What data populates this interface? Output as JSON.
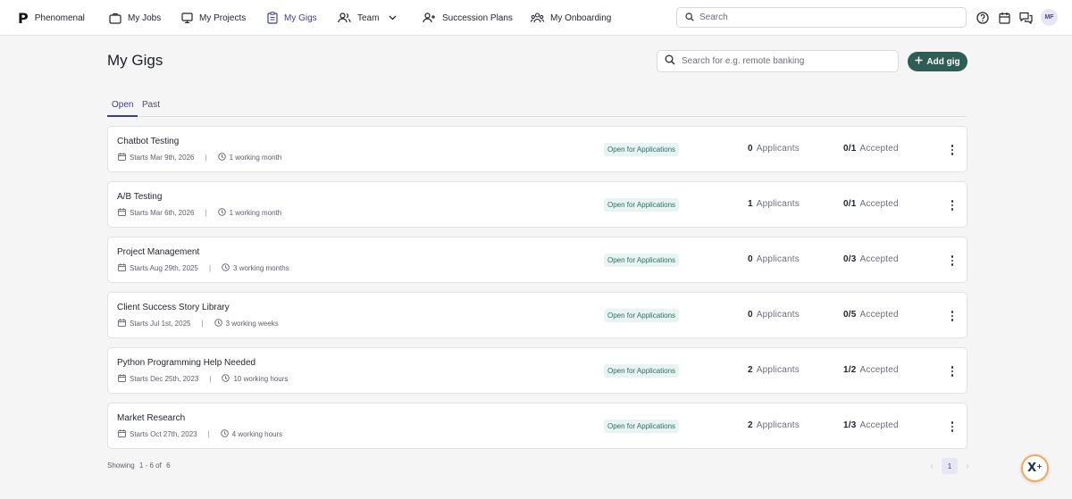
{
  "brand": {
    "name": "Phenomenal"
  },
  "nav": {
    "my_jobs": "My Jobs",
    "my_projects": "My Projects",
    "my_gigs": "My Gigs",
    "team": "Team",
    "succession_plans": "Succession Plans",
    "my_onboarding": "My Onboarding"
  },
  "top_search": {
    "placeholder": "Search"
  },
  "user": {
    "initials": "MF"
  },
  "page": {
    "title": "My Gigs",
    "search_placeholder": "Search for e.g. remote banking",
    "add_gig_label": "Add gig"
  },
  "tabs": [
    {
      "label": "Open",
      "active": true
    },
    {
      "label": "Past",
      "active": false
    }
  ],
  "gigs": [
    {
      "title": "Chatbot Testing",
      "starts": "Starts Mar 9th, 2026",
      "duration": "1 working month",
      "status": "Open for Applications",
      "applicants": "0",
      "applicants_label": "Applicants",
      "accepted": "0/1",
      "accepted_label": "Accepted"
    },
    {
      "title": "A/B Testing",
      "starts": "Starts Mar 6th, 2026",
      "duration": "1 working month",
      "status": "Open for Applications",
      "applicants": "1",
      "applicants_label": "Applicants",
      "accepted": "0/1",
      "accepted_label": "Accepted"
    },
    {
      "title": "Project Management",
      "starts": "Starts Aug 29th, 2025",
      "duration": "3 working months",
      "status": "Open for Applications",
      "applicants": "0",
      "applicants_label": "Applicants",
      "accepted": "0/3",
      "accepted_label": "Accepted"
    },
    {
      "title": "Client Success Story Library",
      "starts": "Starts Jul 1st, 2025",
      "duration": "3 working weeks",
      "status": "Open for Applications",
      "applicants": "0",
      "applicants_label": "Applicants",
      "accepted": "0/5",
      "accepted_label": "Accepted"
    },
    {
      "title": "Python Programming Help Needed",
      "starts": "Starts Dec 25th, 2023",
      "duration": "10 working hours",
      "status": "Open for Applications",
      "applicants": "2",
      "applicants_label": "Applicants",
      "accepted": "1/2",
      "accepted_label": "Accepted"
    },
    {
      "title": "Market Research",
      "starts": "Starts Oct 27th, 2023",
      "duration": "4 working hours",
      "status": "Open for Applications",
      "applicants": "2",
      "applicants_label": "Applicants",
      "accepted": "1/3",
      "accepted_label": "Accepted"
    }
  ],
  "footer": {
    "showing_label": "Showing",
    "range": "1 - 6 of",
    "total": "6",
    "current_page": "1"
  },
  "colors": {
    "accent": "#3d3d8d",
    "add_button": "#2f5d55",
    "badge_bg": "#e7f4f1",
    "badge_text": "#2f6f64"
  }
}
